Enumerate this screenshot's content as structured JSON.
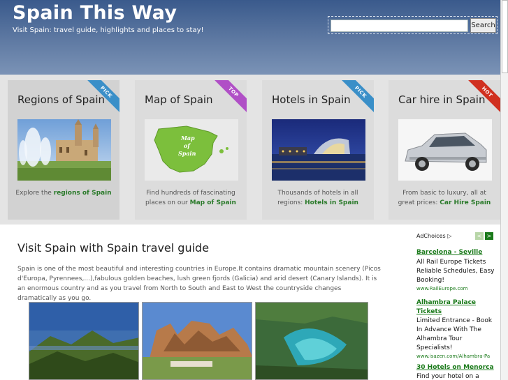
{
  "header": {
    "title": "Spain This Way",
    "tagline": "Visit Spain: travel guide, highlights and places to stay!",
    "search_button": "Search",
    "search_value": ""
  },
  "cards": [
    {
      "title": "Regions of Spain",
      "badge": "PICK",
      "badge_color": "#3a8fc8",
      "desc_prefix": "Explore the",
      "link": "regions of Spain"
    },
    {
      "title": "Map of Spain",
      "badge": "TOP",
      "badge_color": "#b04fc6",
      "desc_prefix": "Find hundreds of fascinating places on our",
      "link": "Map of Spain",
      "map_label_1": "Map",
      "map_label_2": "of",
      "map_label_3": "Spain"
    },
    {
      "title": "Hotels in Spain",
      "badge": "PICK",
      "badge_color": "#3a8fc8",
      "desc_prefix": "Thousands of hotels in all regions:",
      "link": "Hotels in Spain"
    },
    {
      "title": "Car hire in Spain",
      "badge": "HOT",
      "badge_color": "#d03020",
      "desc_prefix": "From basic to luxury, all at great prices:",
      "link": "Car Hire Spain"
    }
  ],
  "main": {
    "title": "Visit Spain with Spain travel guide",
    "intro": "Spain is one of the most beautiful and interesting countries in Europe.It contains dramatic mountain scenery (Picos d'Europa, Pyrennees,...),fabulous golden beaches, lush green fjords (Galicia) and arid desert (Canary Islands). It is an enormous country and as you travel from North to South and East to West the countryside changes dramatically as you go."
  },
  "ads": {
    "adchoices": "AdChoices",
    "prev": "<",
    "next": ">",
    "items": [
      {
        "title": "Barcelona - Seville",
        "text": "All Rail Europe Tickets Reliable Schedules, Easy Booking!",
        "url": "www.RailEurope.com"
      },
      {
        "title": "Alhambra Palace Tickets",
        "text": "Limited Entrance - Book In Advance With The Alhambra Tour Specialists!",
        "url": "www.isazen.com/Alhambra-Pa"
      },
      {
        "title": "30 Hotels on Menorca",
        "text": "Find your hotel on a map.",
        "url": ""
      }
    ]
  }
}
